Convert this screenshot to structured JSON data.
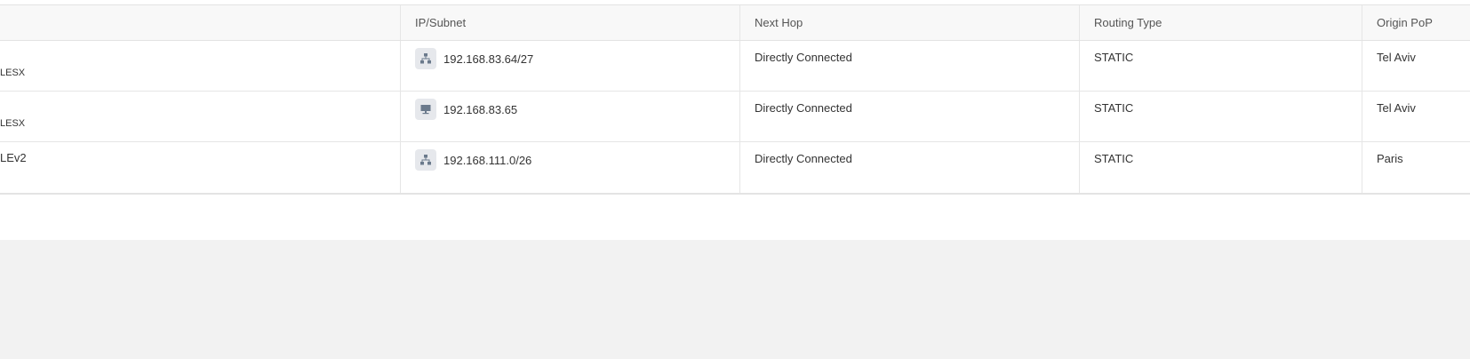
{
  "table": {
    "headers": {
      "name": "",
      "ip_subnet": "IP/Subnet",
      "next_hop": "Next Hop",
      "routing_type": "Routing Type",
      "origin_pop": "Origin PoP"
    },
    "rows": [
      {
        "name": "LESX",
        "ip_icon": "network-icon",
        "ip": "192.168.83.64/27",
        "next_hop": "Directly Connected",
        "routing_type": "STATIC",
        "origin_pop": "Tel Aviv"
      },
      {
        "name": "LESX",
        "ip_icon": "host-icon",
        "ip": "192.168.83.65",
        "next_hop": "Directly Connected",
        "routing_type": "STATIC",
        "origin_pop": "Tel Aviv"
      },
      {
        "name": "LEv2",
        "ip_icon": "network-icon",
        "ip": "192.168.111.0/26",
        "next_hop": "Directly Connected",
        "routing_type": "STATIC",
        "origin_pop": "Paris"
      }
    ]
  },
  "colors": {
    "page_background": "#f2f2f2",
    "panel_background": "#ffffff",
    "header_background": "#f8f8f8",
    "border": "#e6e6e6",
    "icon_background": "#e6e8ec",
    "icon_glyph": "#6b7a8c",
    "text": "#333333"
  }
}
